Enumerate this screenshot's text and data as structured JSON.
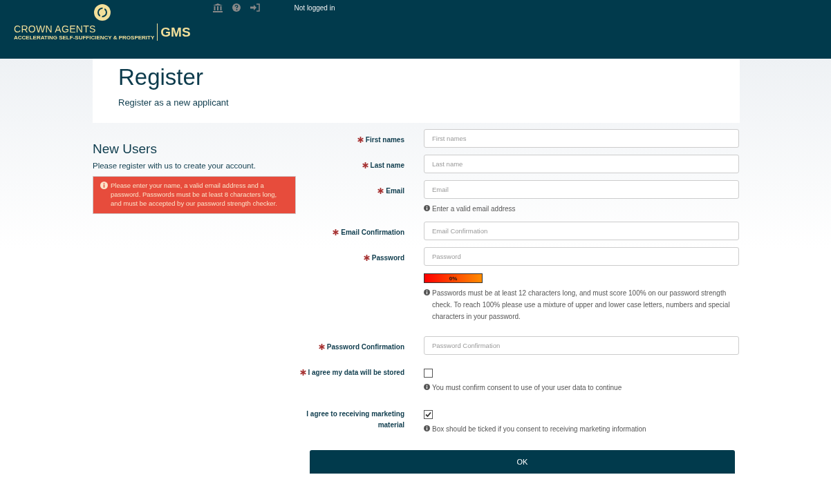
{
  "header": {
    "brand": "CROWN AGENTS",
    "tagline": "ACCELERATING SELF-SUFFICIENCY & PROSPERITY",
    "product": "GMS",
    "status": "Not logged in"
  },
  "intro": {
    "title": "Register",
    "subtitle": "Register as a new applicant"
  },
  "sidebar": {
    "title": "New Users",
    "text": "Please register with us to create your account.",
    "alert": "Please enter your name, a valid email address and a password. Passwords must be at least 8 characters long, and must be accepted by our password strength checker."
  },
  "fields": [
    {
      "kind": "text",
      "label": "First names",
      "required": true,
      "placeholder": "First names"
    },
    {
      "kind": "text",
      "label": "Last name",
      "required": true,
      "placeholder": "Last name"
    },
    {
      "kind": "text",
      "label": "Email",
      "required": true,
      "placeholder": "Email",
      "help": "Enter a valid email address"
    },
    {
      "kind": "text",
      "label": "Email Confirmation",
      "required": true,
      "placeholder": "Email Confirmation"
    },
    {
      "kind": "password",
      "label": "Password",
      "required": true,
      "placeholder": "Password",
      "meter": "0%",
      "help": "Passwords must be at least 12 characters long, and must score 100% on our password strength check. To reach 100% please use a mixture of upper and lower case letters, numbers and special characters in your password."
    },
    {
      "kind": "text",
      "label": "Password Confirmation",
      "required": true,
      "placeholder": "Password Confirmation"
    },
    {
      "kind": "checkbox",
      "label": "I agree my data will be stored",
      "required": true,
      "checked": false,
      "help": "You must confirm consent to use of your user data to continue"
    },
    {
      "kind": "checkbox",
      "label": "I agree to receiving marketing material",
      "required": false,
      "checked": true,
      "help": "Box should be ticked if you consent to receiving marketing information"
    }
  ],
  "submit": "OK"
}
